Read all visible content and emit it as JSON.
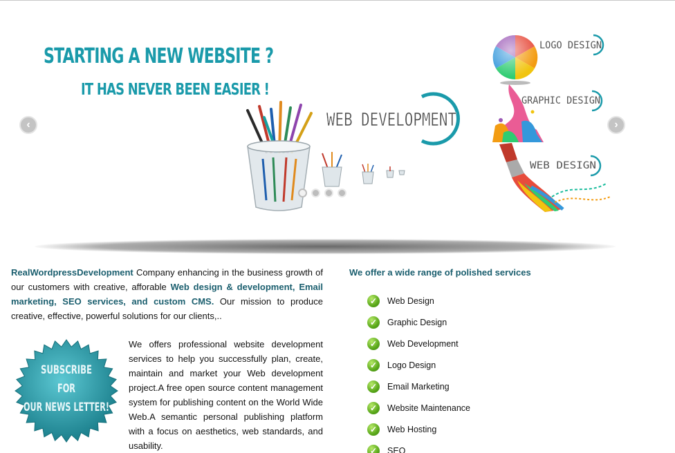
{
  "slider": {
    "headline": "STARTING A NEW WEBSITE ?",
    "subheadline": "IT HAS NEVER BEEN EASIER !",
    "prev_glyph": "‹",
    "next_glyph": "›",
    "slides_count": 4,
    "active_slide": 1,
    "labels": {
      "web_development": "WEB DEVELOPMENT",
      "logo_design": "LOGO DESIGN",
      "graphic_design": "GRAPHIC DESIGN",
      "web_design": "WEB DESIGN"
    },
    "icons": [
      "brush-cup-icon",
      "color-wheel-icon",
      "paint-splash-icon",
      "paint-brush-icon"
    ]
  },
  "intro": {
    "brand": "RealWordpressDevelopment",
    "text1": " Company enhancing in the business growth of our customers with creative, afforable ",
    "highlight1": "Web design & development, Email marketing, SEO services, and custom CMS.",
    "text2": " Our mission to produce creative, effective, powerful solutions for our clients,.."
  },
  "subscribe": {
    "line1": "SUBSCRIBE",
    "line2": "FOR",
    "line3": "OUR NEWS LETTER!"
  },
  "about": {
    "text": "We offers professional website development services to help you successfully plan, create, maintain and market your Web development project.A free open source content management system for publishing content on the World Wide Web.A semantic personal publishing platform with a focus on aesthetics, web standards, and usability."
  },
  "services": {
    "title": "We offer a wide range of polished services",
    "items": [
      {
        "label": "Web Design"
      },
      {
        "label": "Graphic Design"
      },
      {
        "label": "Web Development"
      },
      {
        "label": "Logo Design"
      },
      {
        "label": "Email Marketing"
      },
      {
        "label": "Website Maintenance"
      },
      {
        "label": "Web Hosting"
      },
      {
        "label": "SEO"
      }
    ],
    "check_glyph": "✓"
  },
  "colors": {
    "accent": "#1a9aaa",
    "dark_teal": "#1a5e6e",
    "check_green": "#5aa81a"
  }
}
